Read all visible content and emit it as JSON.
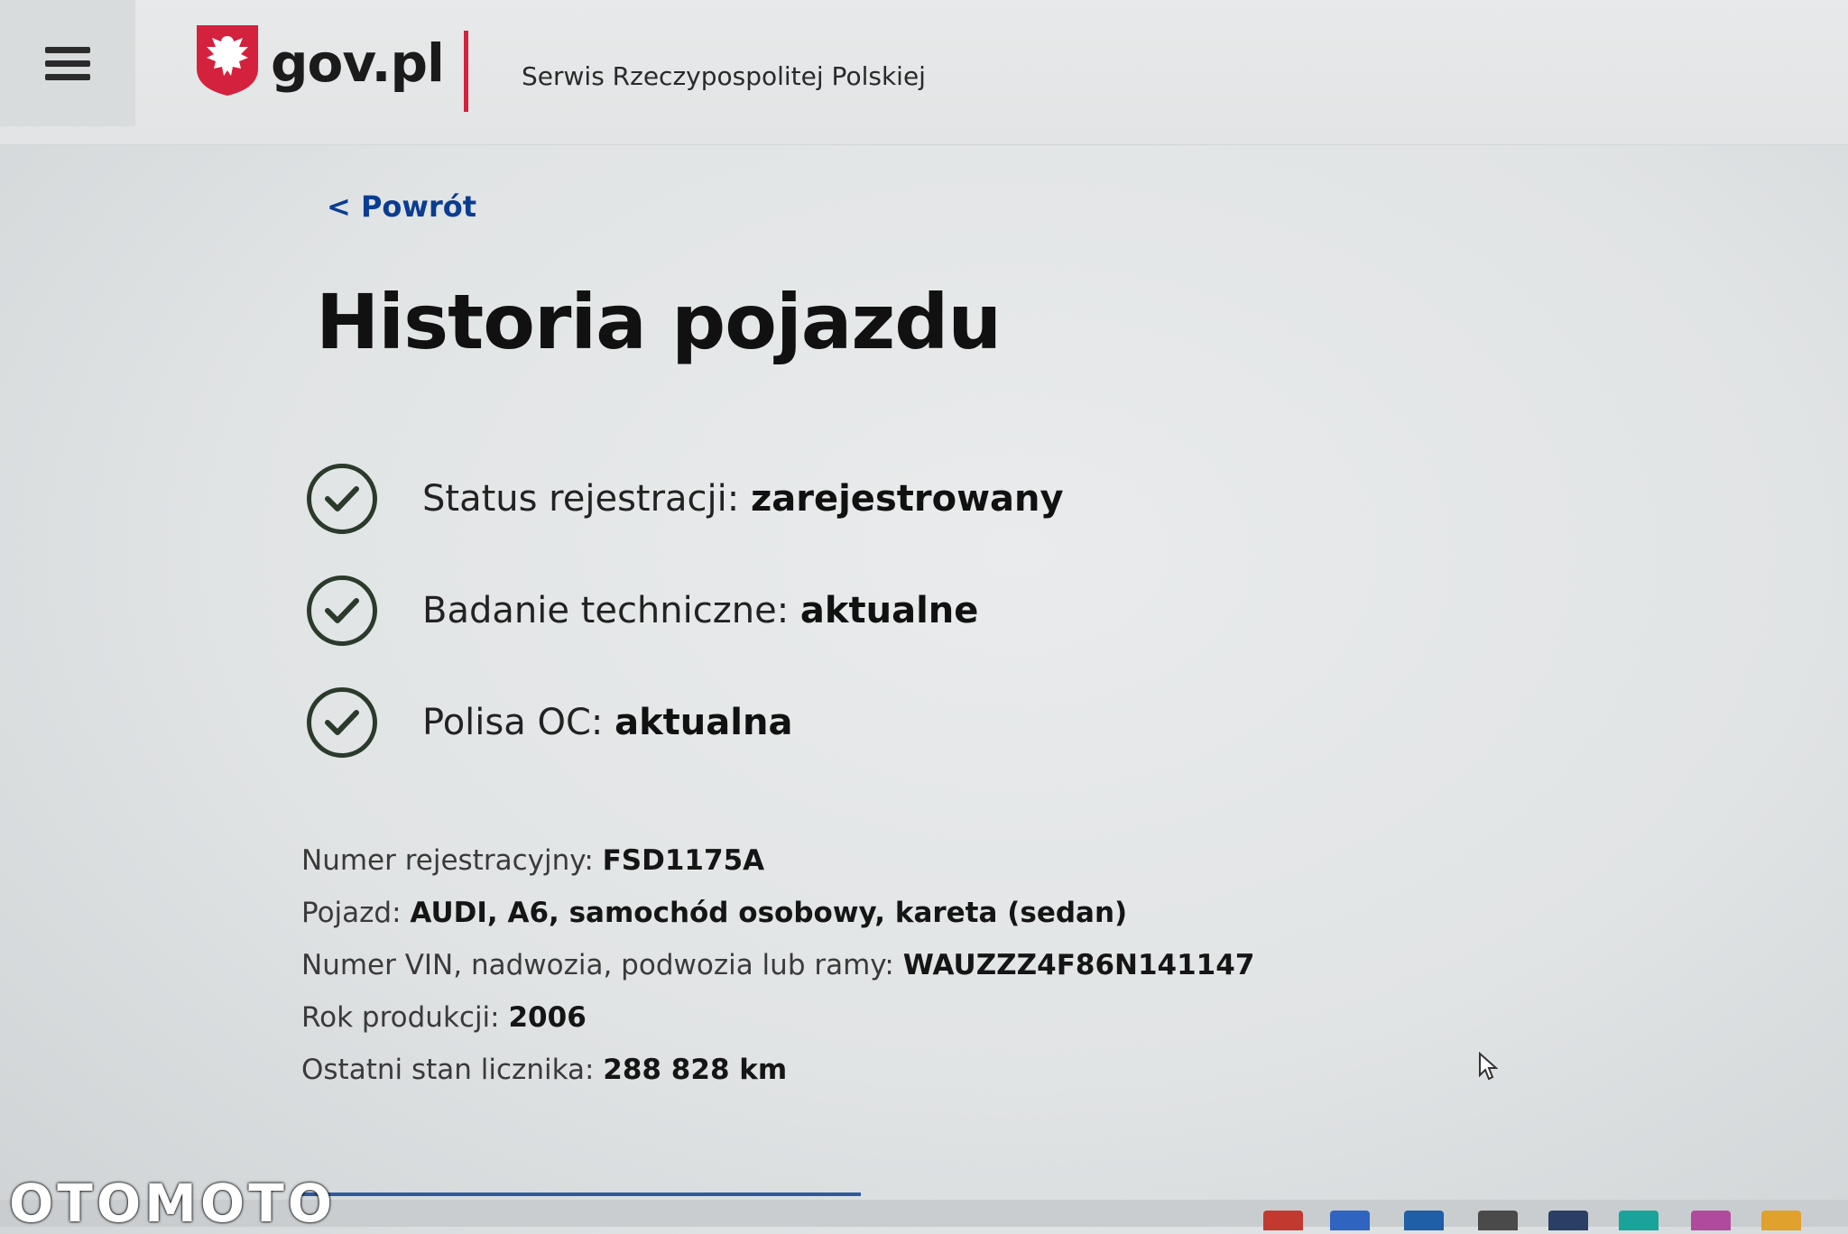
{
  "header": {
    "logo_text": "gov.pl",
    "service_name": "Serwis Rzeczypospolitej Polskiej"
  },
  "nav": {
    "back_link": "< Powrót"
  },
  "page": {
    "title": "Historia pojazdu"
  },
  "status": [
    {
      "label": "Status rejestracji:",
      "value": "zarejestrowany"
    },
    {
      "label": "Badanie techniczne:",
      "value": "aktualne"
    },
    {
      "label": "Polisa OC:",
      "value": "aktualna"
    }
  ],
  "details": [
    {
      "label": "Numer rejestracyjny:",
      "value": "FSD1175A"
    },
    {
      "label": "Pojazd:",
      "value": "AUDI, A6, samochód osobowy, kareta (sedan)"
    },
    {
      "label": "Numer VIN, nadwozia, podwozia lub ramy:",
      "value": "WAUZZZ4F86N141147"
    },
    {
      "label": "Rok produkcji:",
      "value": "2006"
    },
    {
      "label": "Ostatni stan licznika:",
      "value": "288 828 km"
    }
  ],
  "watermark": "OTOMOTO",
  "colors": {
    "accent_red": "#d4213d",
    "link_blue": "#0a3d91",
    "check_dark": "#2b3a2b"
  },
  "icons": {
    "menu": "hamburger-icon",
    "logo": "polish-eagle-icon",
    "status": "check-circle-icon",
    "cursor": "mouse-cursor-icon"
  }
}
